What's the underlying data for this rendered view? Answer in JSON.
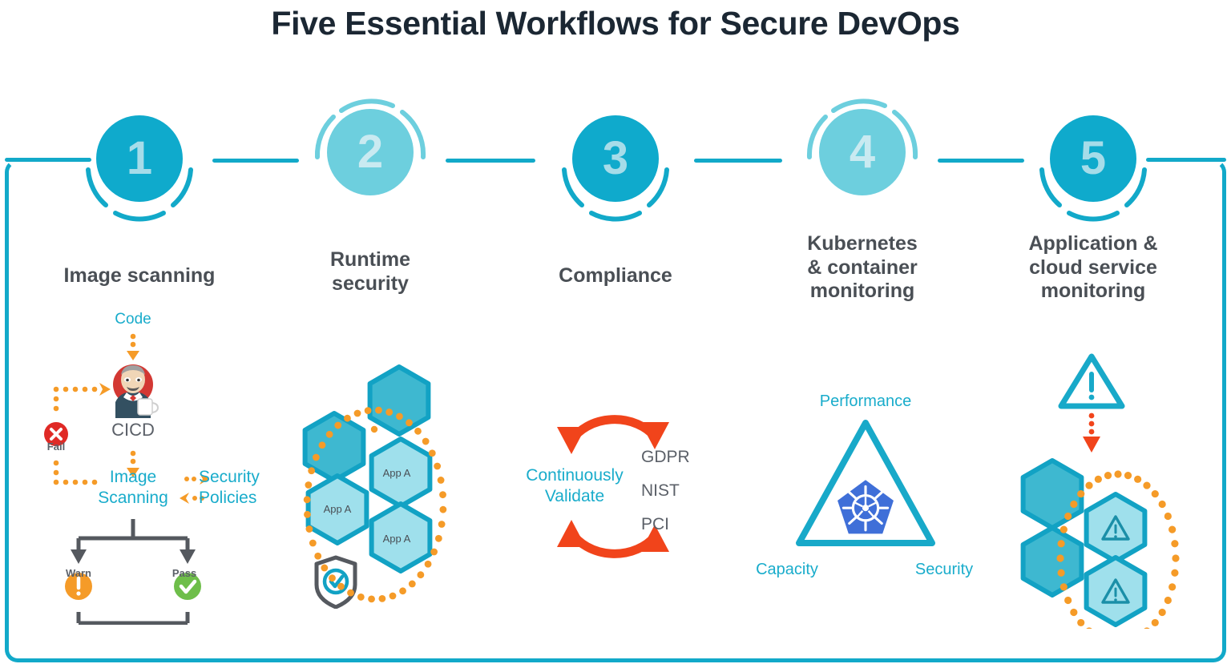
{
  "page": {
    "title": "Five Essential Workflows for Secure DevOps",
    "background": "#ffffff",
    "frame_color": "#12A9C9"
  },
  "colors": {
    "teal_dark": "#0FAACC",
    "teal_light": "#6DCFDE",
    "teal_text": "#19ACCB",
    "gray_text": "#5b6068",
    "orange": "#F59B28",
    "orange_red": "#F1441B",
    "red": "#E02A26",
    "green": "#6EBE4A",
    "kube_blue": "#3F6FD8",
    "arrow_gray": "#55595F",
    "number_light": "#A6DCE9",
    "number_lighter": "#C9EAF1"
  },
  "steps": [
    {
      "number": "1",
      "heading": "Image scanning",
      "tone": "dark",
      "arc": "bottom"
    },
    {
      "number": "2",
      "heading": "Runtime\nsecurity",
      "tone": "light",
      "arc": "top"
    },
    {
      "number": "3",
      "heading": "Compliance",
      "tone": "dark",
      "arc": "bottom"
    },
    {
      "number": "4",
      "heading": "Kubernetes\n& container\nmonitoring",
      "tone": "light",
      "arc": "top"
    },
    {
      "number": "5",
      "heading": "Application &\ncloud service\nmonitoring",
      "tone": "dark",
      "arc": "bottom"
    }
  ],
  "step_headings": {
    "one": "Image scanning",
    "two_l1": "Runtime",
    "two_l2": "security",
    "three": "Compliance",
    "four_l1": "Kubernetes",
    "four_l2": "& container",
    "four_l3": "monitoring",
    "five_l1": "Application &",
    "five_l2": "cloud service",
    "five_l3": "monitoring"
  },
  "column1": {
    "code_label": "Code",
    "cicd_label": "CICD",
    "image_scanning_l1": "Image",
    "image_scanning_l2": "Scanning",
    "security_policies_l1": "Security",
    "security_policies_l2": "Policies",
    "fail_label": "Fail",
    "warn_label": "Warn",
    "pass_label": "Pass",
    "icons": [
      "jenkins-butler-icon",
      "fail-x-icon",
      "warn-exclamation-icon",
      "pass-check-icon"
    ]
  },
  "column2": {
    "hex_labels": [
      "App A",
      "App A",
      "App A"
    ],
    "icons": [
      "hexagon-cluster",
      "orange-dotted-ring",
      "shield-check-icon"
    ]
  },
  "column3": {
    "continuously_validate_l1": "Continuously",
    "continuously_validate_l2": "Validate",
    "standards": [
      "GDPR",
      "NIST",
      "PCI"
    ],
    "icons": [
      "orange-circular-arrows"
    ]
  },
  "column4": {
    "performance_label": "Performance",
    "capacity_label": "Capacity",
    "security_label": "Security",
    "icons": [
      "teal-triangle",
      "kubernetes-helm-icon"
    ]
  },
  "column5": {
    "icons": [
      "warning-triangle-icon",
      "red-dotted-down-arrow",
      "hexagon-cluster-alerts",
      "orange-dotted-ring"
    ]
  }
}
